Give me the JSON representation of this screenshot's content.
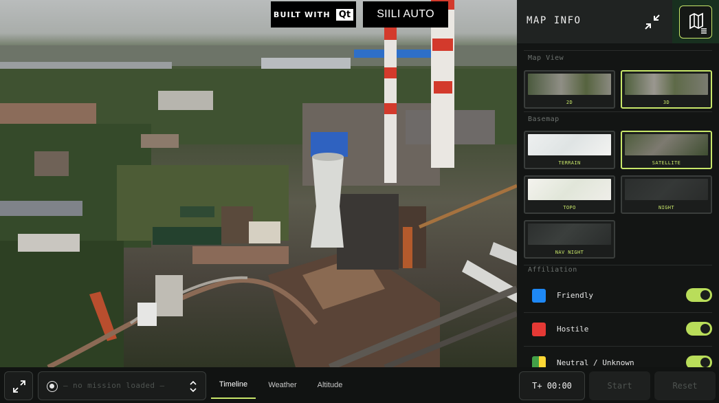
{
  "branding": {
    "built_with": "BUILT WITH",
    "qt_logo": "Qt",
    "siili": "SIILI AUTO"
  },
  "panel": {
    "title": "MAP INFO",
    "sections": {
      "map_view": "Map View",
      "basemap": "Basemap",
      "affiliation": "Affiliation"
    },
    "map_view_tiles": [
      {
        "label": "2D",
        "selected": false
      },
      {
        "label": "3D",
        "selected": true
      }
    ],
    "basemap_tiles": [
      {
        "label": "TERRAIN",
        "selected": false
      },
      {
        "label": "SATELLITE",
        "selected": true
      },
      {
        "label": "TOPO",
        "selected": false
      },
      {
        "label": "NIGHT",
        "selected": false
      },
      {
        "label": "NAV NIGHT",
        "selected": false
      }
    ],
    "affiliations": [
      {
        "label": "Friendly",
        "color": "#1e88f5",
        "enabled": true
      },
      {
        "label": "Hostile",
        "color": "#e53935",
        "enabled": true
      },
      {
        "label": "Neutral / Unknown",
        "colors": [
          "#43a047",
          "#fdd835"
        ],
        "enabled": true
      }
    ]
  },
  "bottom_bar": {
    "mission_placeholder": "— no mission loaded —",
    "tabs": [
      {
        "label": "Timeline",
        "active": true
      },
      {
        "label": "Weather",
        "active": false
      },
      {
        "label": "Altitude",
        "active": false
      }
    ],
    "clock": "T+ 00:00",
    "start_label": "Start",
    "reset_label": "Reset"
  },
  "colors": {
    "accent": "#c9e86a",
    "panel_bg": "#131514"
  },
  "icons": [
    "collapse-icon",
    "map-layers-icon",
    "expand-icon",
    "radio-icon",
    "chevron-updown-icon"
  ]
}
